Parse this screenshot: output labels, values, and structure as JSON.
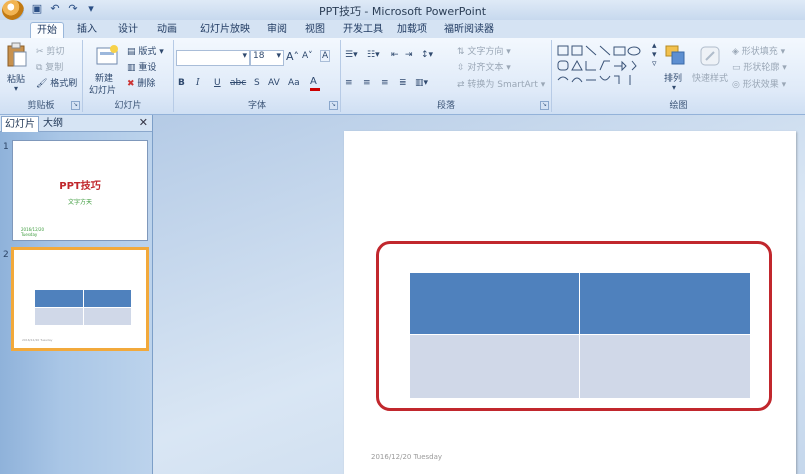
{
  "title": "PPT技巧 - Microsoft PowerPoint",
  "quick_access": {
    "icons": [
      "save-icon",
      "undo-icon",
      "redo-icon",
      "customize-icon"
    ]
  },
  "tabs": [
    {
      "label": "开始",
      "active": true
    },
    {
      "label": "插入"
    },
    {
      "label": "设计"
    },
    {
      "label": "动画"
    },
    {
      "label": "幻灯片放映"
    },
    {
      "label": "审阅"
    },
    {
      "label": "视图"
    },
    {
      "label": "开发工具"
    },
    {
      "label": "加载项"
    },
    {
      "label": "福昕阅读器"
    }
  ],
  "ribbon": {
    "clipboard": {
      "label": "剪贴板",
      "paste": "粘贴",
      "cut": "剪切",
      "copy": "复制",
      "format_painter": "格式刷"
    },
    "slides": {
      "label": "幻灯片",
      "new_slide_1": "新建",
      "new_slide_2": "幻灯片",
      "layout": "版式",
      "reset": "重设",
      "delete": "删除"
    },
    "font": {
      "label": "字体",
      "size": "18",
      "font_name": "",
      "bold": "B",
      "italic": "I",
      "underline": "U",
      "strike": "abc",
      "shadow": "S",
      "spacing": "AV",
      "case": "Aa",
      "grow": "A",
      "shrink": "A",
      "clear": "A"
    },
    "paragraph": {
      "label": "段落",
      "text_direction": "文字方向",
      "align_text": "对齐文本",
      "convert_smartart": "转换为 SmartArt"
    },
    "drawing": {
      "label": "绘图",
      "arrange": "排列",
      "quick_styles": "快速样式",
      "shape_fill": "形状填充",
      "shape_outline": "形状轮廓",
      "shape_effects": "形状效果"
    }
  },
  "left_panel": {
    "tab_slides": "幻灯片",
    "tab_outline": "大纲",
    "slides": [
      {
        "number": "1",
        "title": "PPT技巧",
        "subtitle": "文字方天",
        "date": "2016/12/20",
        "day": "Tuesday"
      },
      {
        "number": "2",
        "date": "2016/12/20 Tuesday"
      }
    ]
  },
  "main_slide": {
    "footer": "2016/12/20 Tuesday",
    "table": {
      "rows": 2,
      "cols": 2,
      "header_color": "#4f81bd",
      "body_color": "#d0d8e8"
    },
    "highlight_color": "#c1272d"
  }
}
